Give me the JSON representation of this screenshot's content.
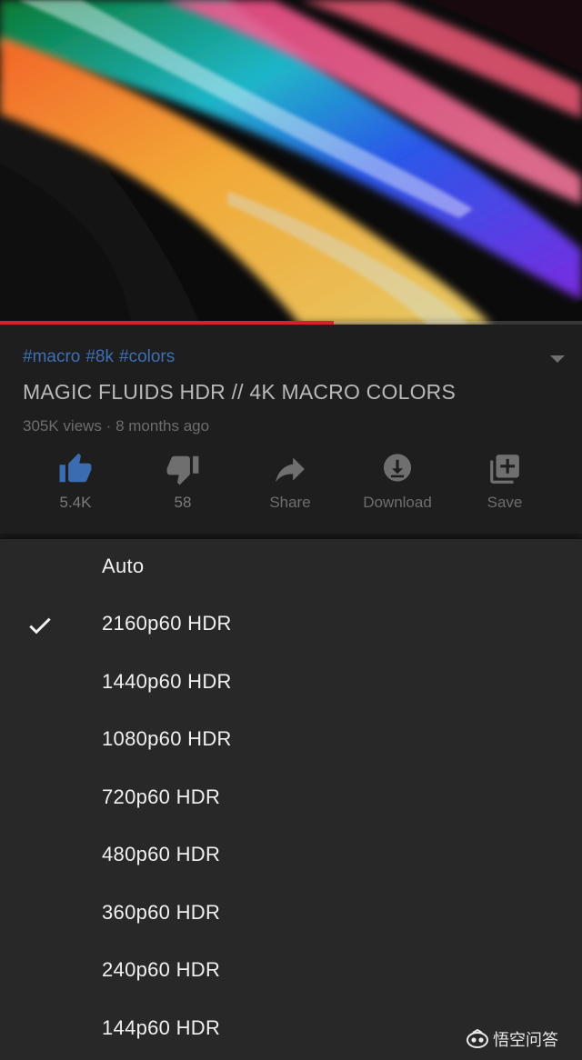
{
  "video": {
    "progress_fraction": 0.573
  },
  "info": {
    "hashtags": [
      "#macro",
      "#8k",
      "#colors"
    ],
    "title": "MAGIC FLUIDS HDR // 4K MACRO COLORS",
    "views": "305K views",
    "separator": "·",
    "age": "8 months ago"
  },
  "actions": [
    {
      "id": "like",
      "label": "5.4K",
      "icon": "thumb-up-icon",
      "active": true
    },
    {
      "id": "dislike",
      "label": "58",
      "icon": "thumb-down-icon",
      "active": false
    },
    {
      "id": "share",
      "label": "Share",
      "icon": "share-arrow-icon",
      "active": false
    },
    {
      "id": "download",
      "label": "Download",
      "icon": "download-icon",
      "active": false
    },
    {
      "id": "save",
      "label": "Save",
      "icon": "add-to-playlist-icon",
      "active": false
    }
  ],
  "quality_menu": {
    "options": [
      "Auto",
      "2160p60 HDR",
      "1440p60 HDR",
      "1080p60 HDR",
      "720p60 HDR",
      "480p60 HDR",
      "360p60 HDR",
      "240p60 HDR",
      "144p60 HDR"
    ],
    "selected": "2160p60 HDR"
  },
  "watermark": {
    "text": "悟空问答"
  },
  "colors": {
    "background": "#181818",
    "sheet": "#282828",
    "hashtag": "#3d6fb2",
    "like_active": "#3b6bb0",
    "progress": "#d4222b",
    "menu_text": "#f1f1f1"
  }
}
